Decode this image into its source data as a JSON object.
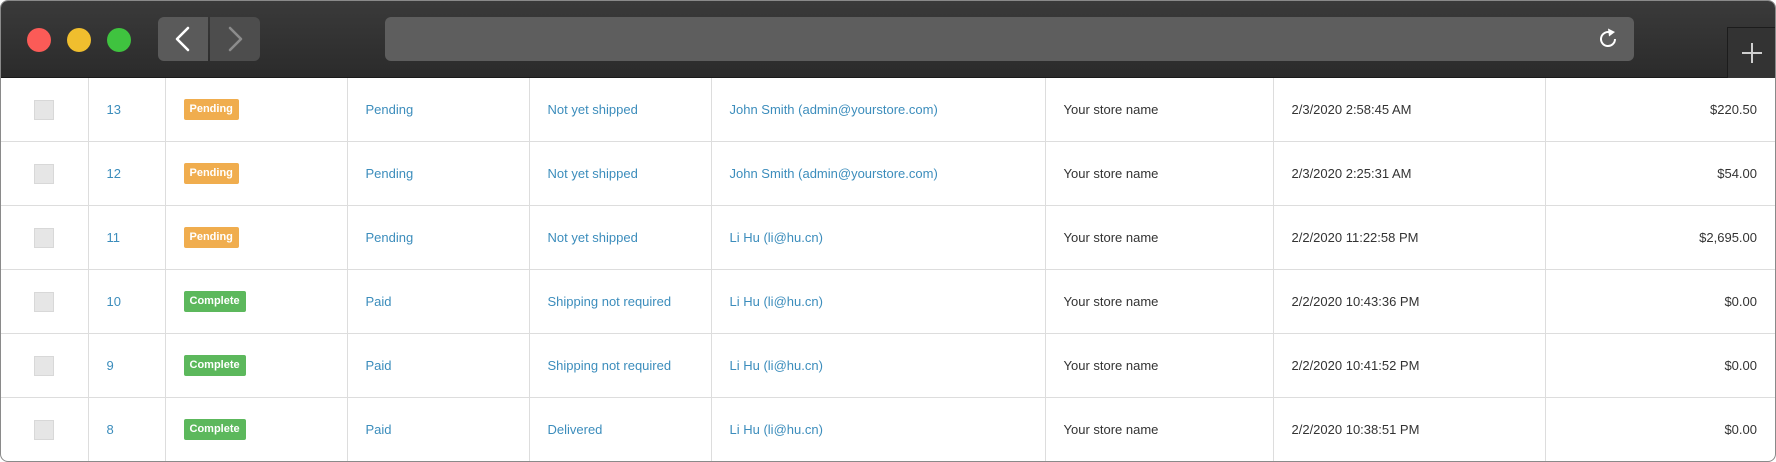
{
  "browser": {
    "back_icon": "chevron-left-icon",
    "forward_icon": "chevron-right-icon",
    "reload_icon": "reload-icon",
    "new_tab_icon": "plus-icon",
    "address": ""
  },
  "colors": {
    "pending": "#f0ad4e",
    "complete": "#5cb85c",
    "link": "#3c8dbc"
  },
  "orders": [
    {
      "id": "13",
      "status": "Pending",
      "status_type": "pending",
      "payment": "Pending",
      "shipping": "Not yet shipped",
      "customer": "John Smith (admin@yourstore.com)",
      "store": "Your store name",
      "created": "2/3/2020 2:58:45 AM",
      "total": "$220.50"
    },
    {
      "id": "12",
      "status": "Pending",
      "status_type": "pending",
      "payment": "Pending",
      "shipping": "Not yet shipped",
      "customer": "John Smith (admin@yourstore.com)",
      "store": "Your store name",
      "created": "2/3/2020 2:25:31 AM",
      "total": "$54.00"
    },
    {
      "id": "11",
      "status": "Pending",
      "status_type": "pending",
      "payment": "Pending",
      "shipping": "Not yet shipped",
      "customer": "Li Hu (li@hu.cn)",
      "store": "Your store name",
      "created": "2/2/2020 11:22:58 PM",
      "total": "$2,695.00"
    },
    {
      "id": "10",
      "status": "Complete",
      "status_type": "complete",
      "payment": "Paid",
      "shipping": "Shipping not required",
      "customer": "Li Hu (li@hu.cn)",
      "store": "Your store name",
      "created": "2/2/2020 10:43:36 PM",
      "total": "$0.00"
    },
    {
      "id": "9",
      "status": "Complete",
      "status_type": "complete",
      "payment": "Paid",
      "shipping": "Shipping not required",
      "customer": "Li Hu (li@hu.cn)",
      "store": "Your store name",
      "created": "2/2/2020 10:41:52 PM",
      "total": "$0.00"
    },
    {
      "id": "8",
      "status": "Complete",
      "status_type": "complete",
      "payment": "Paid",
      "shipping": "Delivered",
      "customer": "Li Hu (li@hu.cn)",
      "store": "Your store name",
      "created": "2/2/2020 10:38:51 PM",
      "total": "$0.00"
    }
  ]
}
